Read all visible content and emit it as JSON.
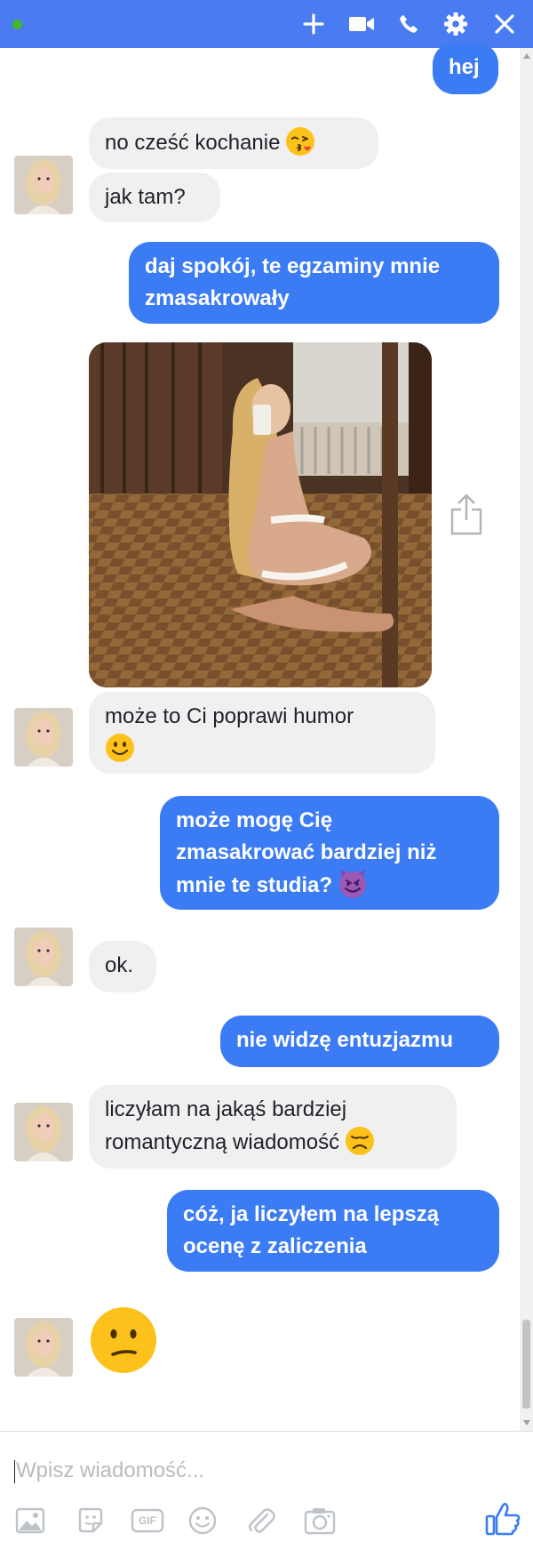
{
  "header": {
    "contact_name": "",
    "icons": [
      "online-status-dot",
      "add-icon",
      "video-call-icon",
      "phone-icon",
      "gear-icon",
      "close-icon"
    ],
    "bar_color": "#4a7bf0"
  },
  "messages": [
    {
      "side": "out",
      "text": "hej"
    },
    {
      "side": "in",
      "text": "no cześć kochanie",
      "emoji": "kissing-face"
    },
    {
      "side": "in",
      "text": "jak tam?"
    },
    {
      "side": "out",
      "text": "daj spokój, te egzaminy mnie\nzmasakrowały"
    },
    {
      "side": "in",
      "type": "photo",
      "description": "mirror-selfie-photo"
    },
    {
      "side": "in",
      "text": "może to Ci poprawi humor",
      "emoji": "slightly-smiling-face"
    },
    {
      "side": "out",
      "text": "może mogę Cię\nzmasakrować bardziej niż\nmnie te studia?",
      "emoji": "smiling-devil-face"
    },
    {
      "side": "in",
      "text": "ok."
    },
    {
      "side": "out",
      "text": "nie widzę entuzjazmu"
    },
    {
      "side": "in",
      "text": "liczyłam na jakąś bardziej\nromantyczną wiadomość",
      "emoji": "disappointed-face"
    },
    {
      "side": "out",
      "text": "cóż, ja liczyłem na lepszą\nocenę z zaliczenia"
    },
    {
      "side": "in",
      "type": "big-emoji",
      "emoji": "confused-face"
    }
  ],
  "composer": {
    "placeholder": "Wpisz wiadomość...",
    "tools": [
      "photo-icon",
      "sticker-icon",
      "gif-icon",
      "emoji-icon",
      "attachment-icon",
      "camera-icon",
      "like-icon"
    ],
    "gif_label": "GIF"
  },
  "colors": {
    "outgoing_bubble": "#3b7cf5",
    "incoming_bubble": "#f1f0f0",
    "like_icon": "#3b7cf5"
  }
}
